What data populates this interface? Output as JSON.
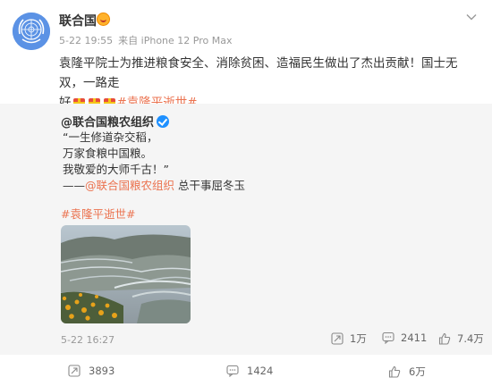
{
  "post": {
    "author": "联合国",
    "time": "5-22 19:55",
    "source": "来自 iPhone 12 Pro Max",
    "text_line1": "袁隆平院士为推进粮食安全、消除贫困、造福民生做出了杰出贡献！国士无双，一路走",
    "text_line2_prefix": "好",
    "hashtag": "#袁隆平逝世#"
  },
  "repost": {
    "author": "@联合国粮农组织",
    "lines": [
      "“一生修道杂交稻，",
      "万家食粮中国粮。",
      "我敬爱的大师千古！”"
    ],
    "signature_prefix": "——",
    "signature_author": "@联合国粮农组织",
    "signature_suffix": " 总干事屈冬玉",
    "hashtag": "#袁隆平逝世#",
    "time": "5-22 16:27",
    "reposts": "1万",
    "comments": "2411",
    "likes": "7.4万"
  },
  "actions": {
    "reposts": "3893",
    "comments": "1424",
    "likes": "6万"
  },
  "icons": {
    "avatar": "un-emblem-icon",
    "badge": "vip-badge-icon",
    "verified": "verified-icon",
    "menu": "chevron-down-icon",
    "repost": "repost-icon",
    "comment": "comment-icon",
    "like": "thumbs-up-icon"
  },
  "colors": {
    "link": "#eb7350",
    "un_blue": "#5b92e5",
    "repost_bg": "#f5f5f5"
  }
}
